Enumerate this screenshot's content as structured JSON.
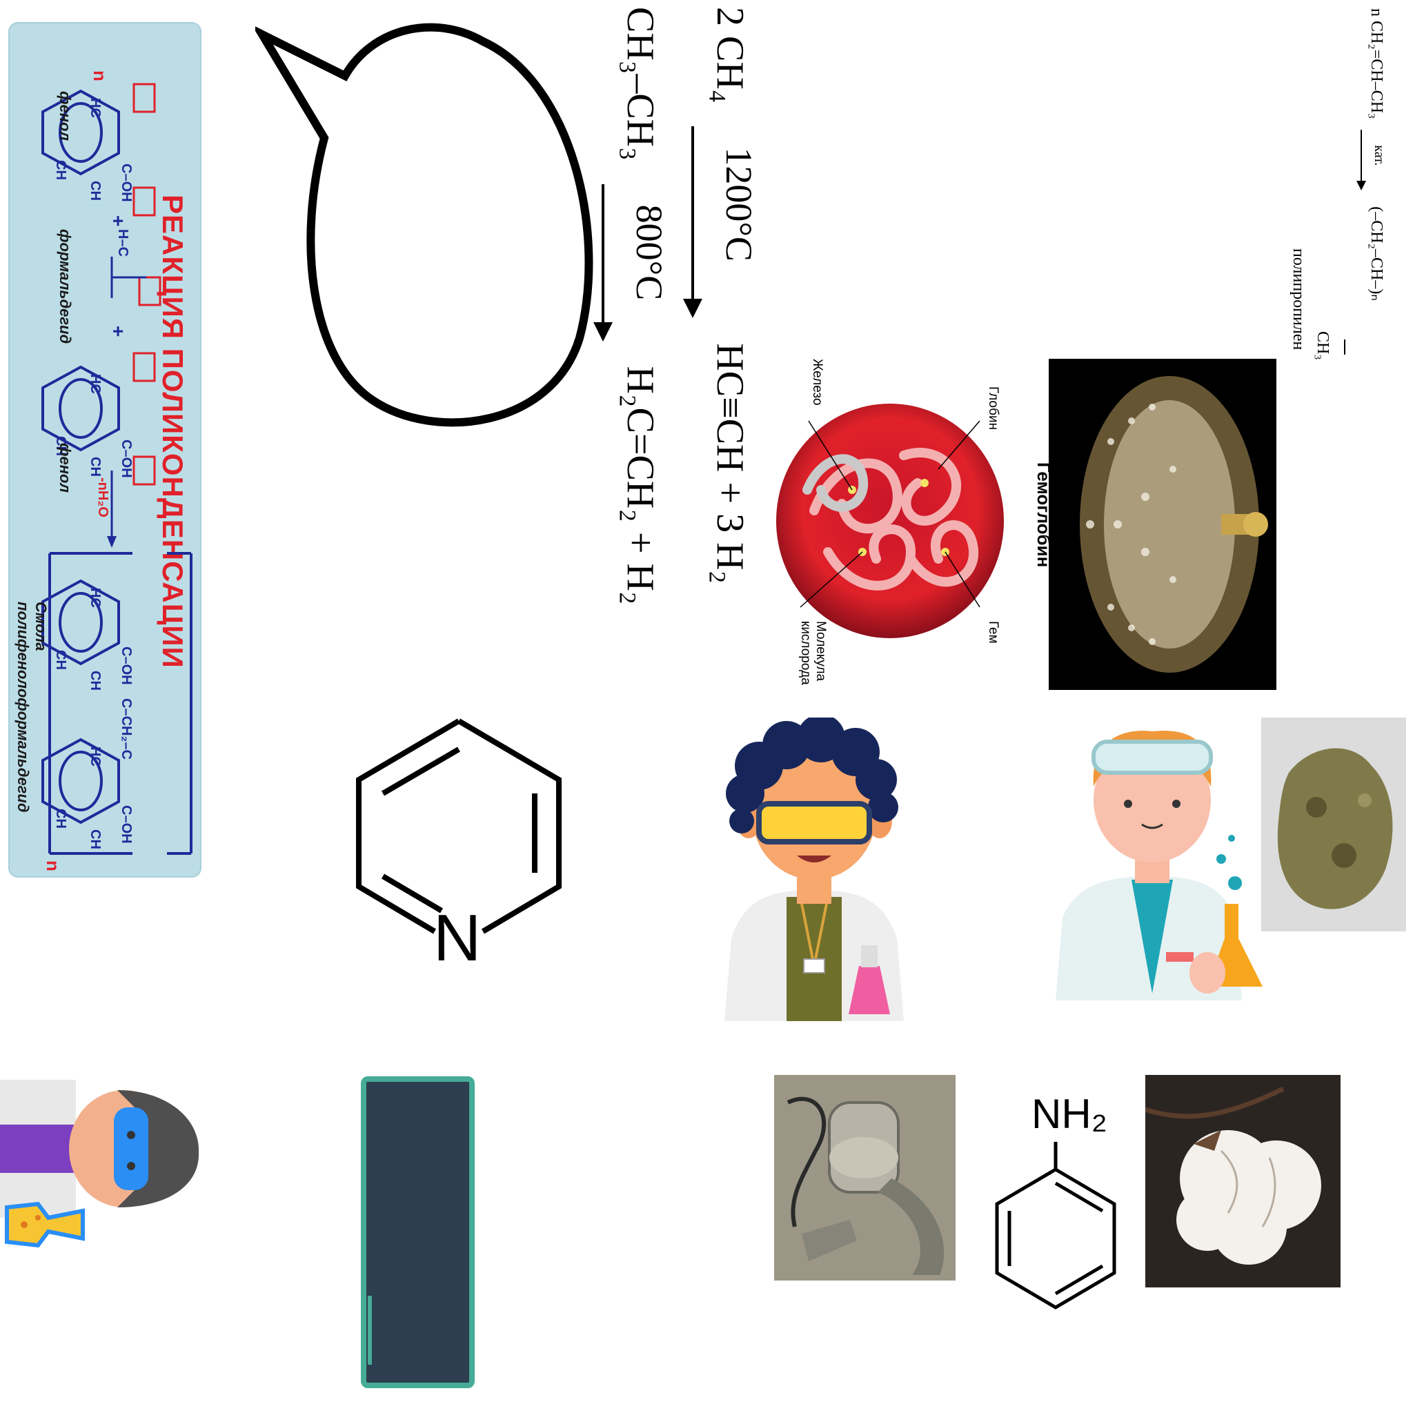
{
  "poly_card": {
    "title": "РЕАКЦИЯ ПОЛИКОНДЕНСАЦИИ",
    "labels": [
      "фенол",
      "формальдегид",
      "фенол",
      "Смола полифенолоформальдегид"
    ],
    "n_left": "n",
    "n_right": "n",
    "water": "-nH₂O",
    "plus1": "+",
    "plus2": "+"
  },
  "equations": {
    "eq1": {
      "left": "2 CH₄",
      "condition": "1200°C",
      "right": "HC≡CH + 3 H₂"
    },
    "eq2": {
      "left": "CH₃–CH₃",
      "condition": "800°C",
      "right": "H₂C=CH₂ + H₂"
    },
    "eq3": {
      "left": "n CH₂=CH–CH₃",
      "sub": "CH₃",
      "condition": "кат.",
      "right": "(–CH₂–CH–)ₙ",
      "name": "полипропилен"
    }
  },
  "hemoglobin": {
    "caption": "Гемоглобин",
    "labels": {
      "globin": "Глобин",
      "iron": "Железо",
      "heme": "Гем",
      "oxygen": "Молекула кислорода"
    }
  },
  "pyridine": {
    "atom": "N"
  },
  "aniline": {
    "group": "NH₂"
  }
}
